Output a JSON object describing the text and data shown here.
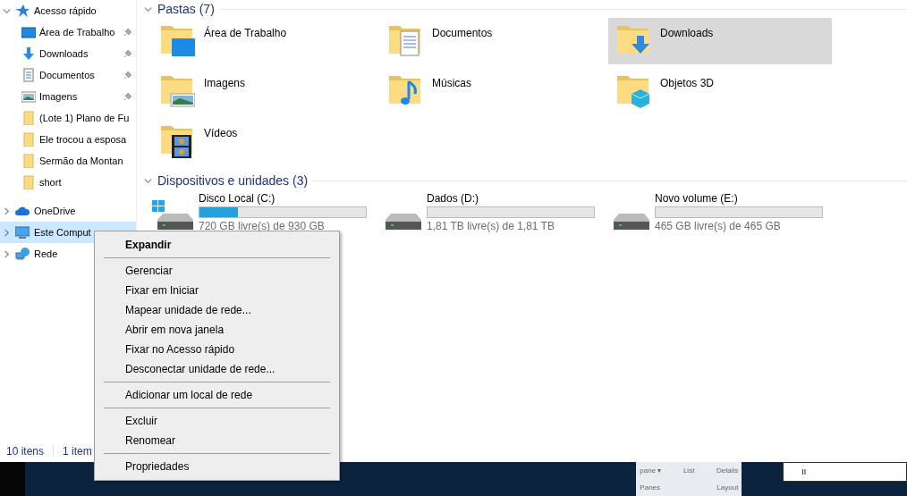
{
  "sidebar": {
    "items": [
      {
        "label": "Acesso rápido",
        "kind": "star",
        "expanded": true,
        "selected": false,
        "children": [
          {
            "label": "Área de Trabalho",
            "kind": "desktop",
            "pinned": true,
            "selected": false
          },
          {
            "label": "Downloads",
            "kind": "download",
            "pinned": true,
            "selected": false
          },
          {
            "label": "Documentos",
            "kind": "docs",
            "pinned": true,
            "selected": false
          },
          {
            "label": "Imagens",
            "kind": "images",
            "pinned": true,
            "selected": false
          },
          {
            "label": "(Lote 1) Plano de Fu",
            "kind": "folder",
            "pinned": false,
            "selected": false
          },
          {
            "label": "Ele trocou a esposa",
            "kind": "folder",
            "pinned": false,
            "selected": false
          },
          {
            "label": "Sermão da Montan",
            "kind": "folder",
            "pinned": false,
            "selected": false
          },
          {
            "label": "short",
            "kind": "folder",
            "pinned": false,
            "selected": false
          }
        ]
      },
      {
        "label": "OneDrive",
        "kind": "cloud",
        "expanded": false,
        "selected": false
      },
      {
        "label": "Este Comput",
        "kind": "pc",
        "expanded": false,
        "selected": true
      },
      {
        "label": "Rede",
        "kind": "network",
        "expanded": false,
        "selected": false
      }
    ]
  },
  "folders": {
    "title": "Pastas (7)",
    "expanded": true,
    "items": [
      {
        "label": "Área de Trabalho",
        "kind": "desktop",
        "selected": false
      },
      {
        "label": "Documentos",
        "kind": "docs",
        "selected": false
      },
      {
        "label": "Downloads",
        "kind": "download",
        "selected": true
      },
      {
        "label": "Imagens",
        "kind": "images",
        "selected": false
      },
      {
        "label": "Músicas",
        "kind": "music",
        "selected": false
      },
      {
        "label": "Objetos 3D",
        "kind": "cube",
        "selected": false
      },
      {
        "label": "Vídeos",
        "kind": "video",
        "selected": false
      }
    ]
  },
  "drives": {
    "title": "Dispositivos e unidades (3)",
    "expanded": true,
    "items": [
      {
        "name": "Disco Local (C:)",
        "kind": "system",
        "level": 0.23,
        "free": "720 GB livre(s) de 930 GB"
      },
      {
        "name": "Dados (D:)",
        "kind": "plain",
        "level": 0,
        "free": "1,81 TB livre(s) de 1,81 TB"
      },
      {
        "name": "Novo volume (E:)",
        "kind": "plain",
        "level": 0,
        "free": "465 GB livre(s) de 465 GB"
      }
    ]
  },
  "status_bar": [
    "10 itens",
    "1 item"
  ],
  "context_menu": {
    "groups": [
      [
        {
          "label": "Expandir",
          "default": true
        }
      ],
      [
        {
          "label": "Gerenciar",
          "default": false
        },
        {
          "label": "Fixar em Iniciar",
          "default": false
        },
        {
          "label": "Mapear unidade de rede...",
          "default": false
        },
        {
          "label": "Abrir em nova janela",
          "default": false
        },
        {
          "label": "Fixar no Acesso rápido",
          "default": false
        },
        {
          "label": "Desconectar unidade de rede...",
          "default": false
        }
      ],
      [
        {
          "label": "Adicionar um local de rede",
          "default": false
        }
      ],
      [
        {
          "label": "Excluir",
          "default": false
        },
        {
          "label": "Renomear",
          "default": false
        }
      ],
      [
        {
          "label": "Propriedades",
          "default": false
        }
      ]
    ]
  },
  "preview_window": {
    "ribbon": [
      "pane ▾",
      "List",
      "Details"
    ],
    "groups": [
      "Panes",
      "Layout"
    ],
    "side_button": "II"
  }
}
